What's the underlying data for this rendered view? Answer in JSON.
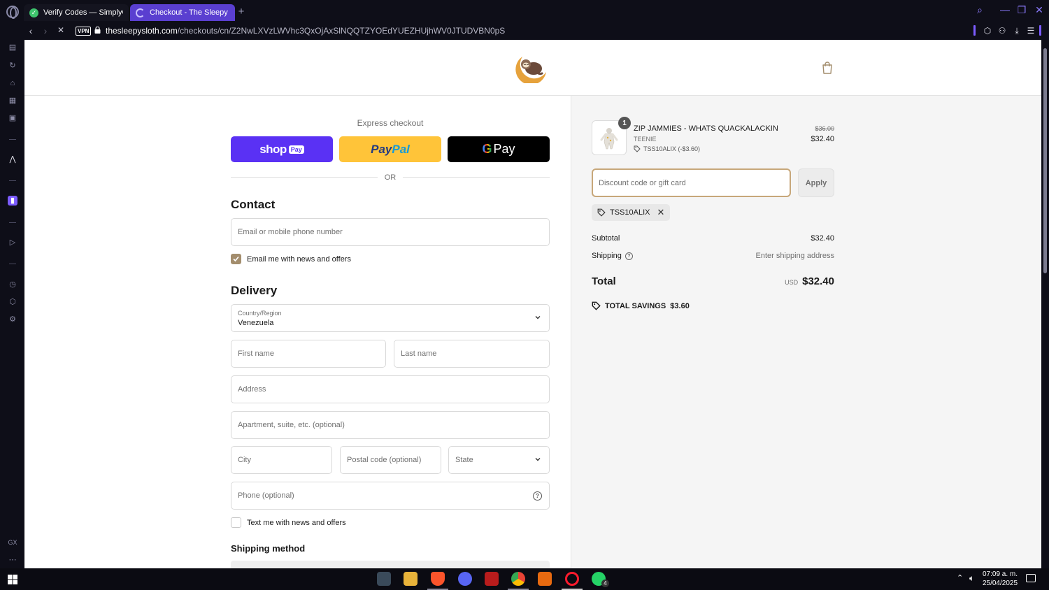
{
  "browser": {
    "tabs": [
      {
        "title": "Verify Codes — SimplyCo"
      },
      {
        "title": "Checkout - The Sleepy Sl"
      }
    ],
    "new_tab": "+",
    "vpn": "VPN",
    "url_domain": "thesleepysloth.com",
    "url_path": "/checkouts/cn/Z2NwLXVzLWVhc3QxOjAxSlNQQTZYOEdYUEZHUjhWV0JTUDVBN0pS"
  },
  "checkout": {
    "express_label": "Express checkout",
    "shop_pay": {
      "text": "shop",
      "badge": "Pay"
    },
    "paypal": {
      "part1": "Pay",
      "part2": "Pal"
    },
    "gpay": {
      "g": "G",
      "text": "Pay"
    },
    "or": "OR",
    "contact": {
      "title": "Contact",
      "email_placeholder": "Email or mobile phone number",
      "newsletter_label": "Email me with news and offers",
      "newsletter_checked": true
    },
    "delivery": {
      "title": "Delivery",
      "country_label": "Country/Region",
      "country_value": "Venezuela",
      "first_name": "First name",
      "last_name": "Last name",
      "address": "Address",
      "apartment": "Apartment, suite, etc. (optional)",
      "city": "City",
      "postal": "Postal code (optional)",
      "state": "State",
      "phone": "Phone (optional)",
      "sms_label": "Text me with news and offers",
      "sms_checked": false
    },
    "shipping_method_title": "Shipping method"
  },
  "summary": {
    "item": {
      "quantity": "1",
      "name": "ZIP JAMMIES - WHATS QUACKALACKIN",
      "variant": "TEENIE",
      "discount": "TSS10ALIX (-$3.60)",
      "original_price": "$36.00",
      "price": "$32.40"
    },
    "discount_placeholder": "Discount code or gift card",
    "apply": "Apply",
    "applied_code": "TSS10ALIX",
    "subtotal_label": "Subtotal",
    "subtotal": "$32.40",
    "shipping_label": "Shipping",
    "shipping_value": "Enter shipping address",
    "total_label": "Total",
    "currency": "USD",
    "total": "$32.40",
    "savings": "TOTAL SAVINGS  $3.60"
  },
  "taskbar": {
    "time": "07:09 a. m.",
    "date": "25/04/2025",
    "whatsapp_badge": "4"
  },
  "colors": {
    "accent_brand": "#a38d6d",
    "focus_border": "#c7a77a",
    "shop_pay": "#5a31f4",
    "paypal": "#ffc439",
    "opera_accent": "#7c5cff"
  }
}
